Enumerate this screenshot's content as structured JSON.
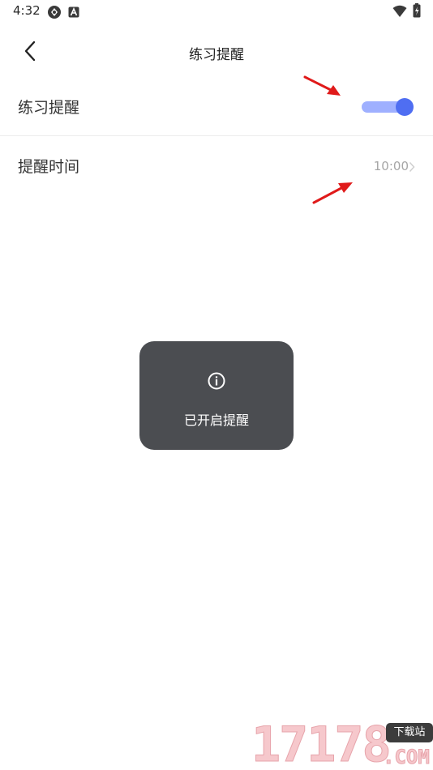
{
  "status_bar": {
    "time": "4:32",
    "left_icons": [
      "sync-icon",
      "a-icon"
    ],
    "right_icons": [
      "wifi-icon",
      "battery-icon"
    ]
  },
  "header": {
    "back_icon": "chevron-left-icon",
    "title": "练习提醒"
  },
  "settings": {
    "reminder_label": "练习提醒",
    "reminder_enabled": true,
    "time_label": "提醒时间",
    "time_value": "10:00"
  },
  "toast": {
    "icon": "info-icon",
    "message": "已开启提醒"
  },
  "watermark": {
    "digits": "17178",
    "badge": "下载站",
    "suffix": ".COM"
  },
  "colors": {
    "accent": "#4f6ef2",
    "toggle_track": "#9fb0ff",
    "toast_bg": "#4b4d51",
    "arrow": "#e01a1a"
  }
}
